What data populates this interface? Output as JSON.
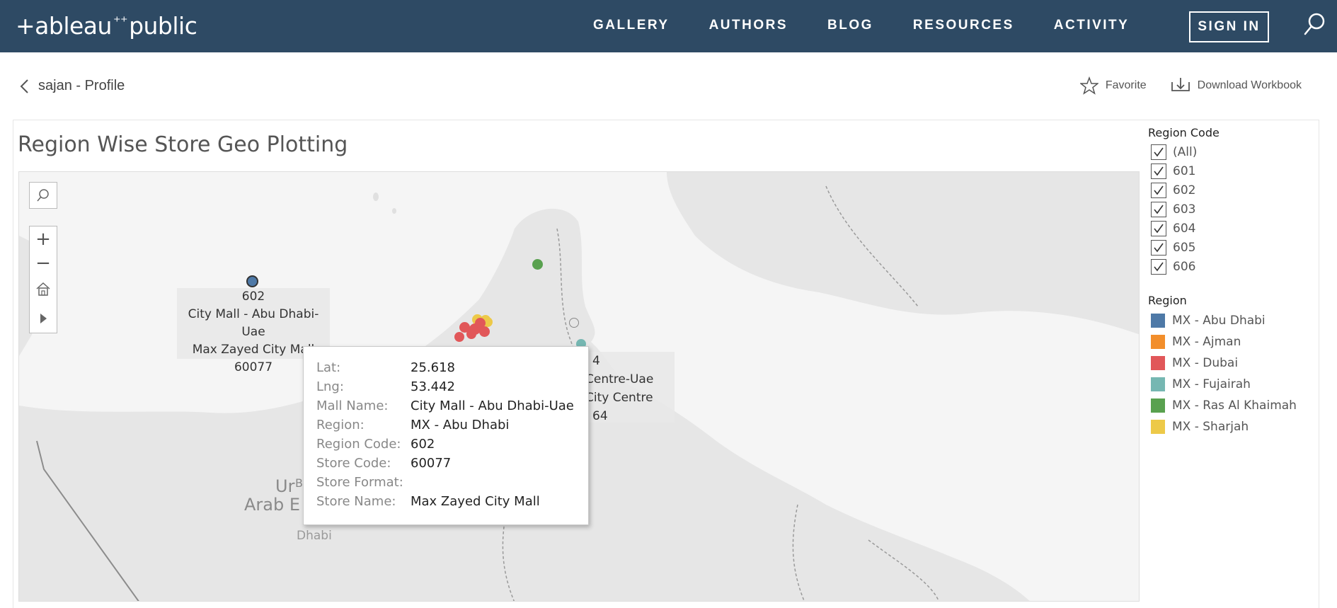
{
  "header": {
    "logo_text": "+ableau",
    "logo_text2": "public",
    "nav": [
      "GALLERY",
      "AUTHORS",
      "BLOG",
      "RESOURCES",
      "ACTIVITY"
    ],
    "sign_in": "SIGN IN"
  },
  "subheader": {
    "back_label": "sajan - Profile",
    "favorite_label": "Favorite",
    "download_label": "Download Workbook"
  },
  "viz": {
    "title": "Region Wise Store Geo Plotting",
    "map_labels": {
      "country": "Ur",
      "country_line2": "Arab E",
      "city": "Dhabi",
      "city_b": "B"
    },
    "label_left": {
      "region_code": "602",
      "mall_name": "City Mall - Abu Dhabi-Uae",
      "store_name": "Max Zayed City Mall",
      "store_code": "60077"
    },
    "label_right": {
      "line1": "4",
      "line2": "Centre-Uae",
      "line3": "City Centre",
      "line4": "64"
    },
    "tooltip": {
      "rows": [
        {
          "key": "Lat:",
          "value": "25.618"
        },
        {
          "key": "Lng:",
          "value": "53.442"
        },
        {
          "key": "Mall Name:",
          "value": "City Mall - Abu Dhabi-Uae"
        },
        {
          "key": "Region:",
          "value": "MX - Abu Dhabi"
        },
        {
          "key": "Region Code:",
          "value": "602"
        },
        {
          "key": "Store Code:",
          "value": "60077"
        },
        {
          "key": "Store Format:",
          "value": ""
        },
        {
          "key": "Store Name:",
          "value": "Max Zayed City Mall"
        }
      ]
    }
  },
  "filters": {
    "region_code": {
      "title": "Region Code",
      "options": [
        "(All)",
        "601",
        "602",
        "603",
        "604",
        "605",
        "606"
      ]
    },
    "region": {
      "title": "Region",
      "items": [
        {
          "label": "MX - Abu Dhabi",
          "color": "#4e79a7"
        },
        {
          "label": "MX - Ajman",
          "color": "#f28e2b"
        },
        {
          "label": "MX - Dubai",
          "color": "#e15759"
        },
        {
          "label": "MX - Fujairah",
          "color": "#76b7b2"
        },
        {
          "label": "MX - Ras Al Khaimah",
          "color": "#59a14f"
        },
        {
          "label": "MX - Sharjah",
          "color": "#edc948"
        }
      ]
    }
  },
  "icons": {
    "search": "search-icon",
    "star": "star-icon",
    "download": "download-icon",
    "back": "chevron-left-icon",
    "zoom_in": "plus-icon",
    "zoom_out": "minus-icon",
    "home": "home-icon",
    "play": "play-icon",
    "check": "check-icon"
  }
}
